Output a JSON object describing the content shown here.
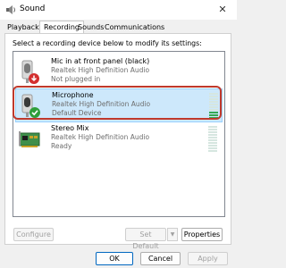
{
  "window": {
    "title": "Sound",
    "close_glyph": "✕"
  },
  "tabs": [
    {
      "label": "Playback",
      "active": false
    },
    {
      "label": "Recording",
      "active": true
    },
    {
      "label": "Sounds",
      "active": false
    },
    {
      "label": "Communications",
      "active": false
    }
  ],
  "instruction": "Select a recording device below to modify its settings:",
  "devices": [
    {
      "name": "Mic in at front panel (black)",
      "driver": "Realtek High Definition Audio",
      "status": "Not plugged in",
      "icon": "microphone-unplugged-icon",
      "level": 0
    },
    {
      "name": "Microphone",
      "driver": "Realtek High Definition Audio",
      "status": "Default Device",
      "icon": "microphone-default-icon",
      "level": 0.3,
      "selected": true
    },
    {
      "name": "Stereo Mix",
      "driver": "Realtek High Definition Audio",
      "status": "Ready",
      "icon": "sound-card-icon",
      "level": 0
    }
  ],
  "buttons": {
    "configure": "Configure",
    "set_default": "Set Default",
    "dropdown_glyph": "▼",
    "properties": "Properties",
    "ok": "OK",
    "cancel": "Cancel",
    "apply": "Apply"
  },
  "colors": {
    "selection": "#cde8fb",
    "highlight_outline": "#c0392b",
    "level_on": "#34a853",
    "default_badge": "#2e9e3a",
    "unplugged_badge": "#d32f2f"
  }
}
